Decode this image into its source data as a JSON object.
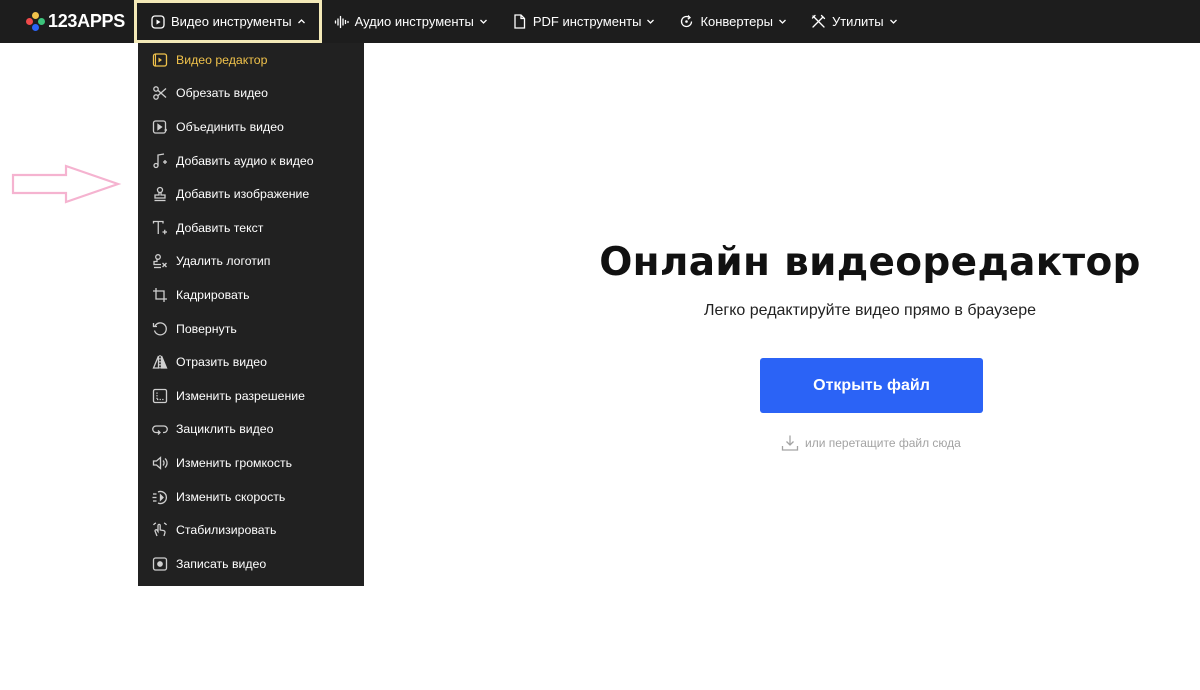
{
  "brand": {
    "name": "123APPS",
    "dot_colors": [
      "#f0c24b",
      "#ef4a4a",
      "#2b63f6",
      "#3cc47c"
    ]
  },
  "nav": {
    "items": [
      {
        "label": "Видео инструменты",
        "icon": "play-box-icon",
        "active": true
      },
      {
        "label": "Аудио инструменты",
        "icon": "waveform-icon",
        "active": false
      },
      {
        "label": "PDF инструменты",
        "icon": "document-icon",
        "active": false
      },
      {
        "label": "Конвертеры",
        "icon": "refresh-icon",
        "active": false
      },
      {
        "label": "Утилиты",
        "icon": "tools-icon",
        "active": false
      }
    ]
  },
  "dropdown": {
    "items": [
      {
        "label": "Видео редактор",
        "icon": "video-edit-icon",
        "selected": true
      },
      {
        "label": "Обрезать видео",
        "icon": "scissors-icon"
      },
      {
        "label": "Объединить видео",
        "icon": "merge-video-icon"
      },
      {
        "label": "Добавить аудио к видео",
        "icon": "music-note-icon"
      },
      {
        "label": "Добавить изображение",
        "icon": "stamp-icon"
      },
      {
        "label": "Добавить текст",
        "icon": "text-add-icon"
      },
      {
        "label": "Удалить логотип",
        "icon": "remove-logo-icon"
      },
      {
        "label": "Кадрировать",
        "icon": "crop-icon"
      },
      {
        "label": "Повернуть",
        "icon": "rotate-icon"
      },
      {
        "label": "Отразить видео",
        "icon": "flip-icon"
      },
      {
        "label": "Изменить разрешение",
        "icon": "resolution-icon"
      },
      {
        "label": "Зациклить видео",
        "icon": "loop-icon"
      },
      {
        "label": "Изменить громкость",
        "icon": "volume-icon"
      },
      {
        "label": "Изменить скорость",
        "icon": "speed-icon"
      },
      {
        "label": "Стабилизировать",
        "icon": "stabilize-icon"
      },
      {
        "label": "Записать видео",
        "icon": "record-icon"
      }
    ]
  },
  "hero": {
    "title": "Онлайн видеоредактор",
    "subtitle": "Легко редактируйте видео прямо в браузере",
    "open_button": "Открыть файл",
    "drop_hint": "или перетащите файл сюда"
  },
  "colors": {
    "topbar_bg": "#1d1d1d",
    "active_border": "#f3e9b7",
    "selected_item": "#f0c24b",
    "primary_button": "#2b63f6",
    "annotation_arrow": "#f5b3d0"
  }
}
